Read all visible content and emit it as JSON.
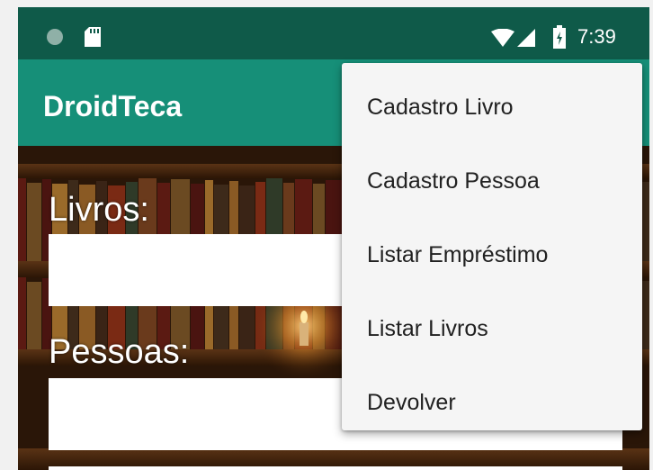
{
  "status_bar": {
    "time": "7:39",
    "icons": [
      "notification-dot-icon",
      "sd-card-icon",
      "wifi-icon",
      "signal-icon",
      "battery-icon"
    ],
    "color": "#0f5a49"
  },
  "app_bar": {
    "title": "DroidTeca",
    "color": "#168f78"
  },
  "form": {
    "livros_label": "Livros:",
    "livros_value": "",
    "pessoas_label": "Pessoas:",
    "pessoas_value": ""
  },
  "overflow_menu": {
    "items": [
      {
        "label": "Cadastro Livro"
      },
      {
        "label": "Cadastro Pessoa"
      },
      {
        "label": "Listar Empréstimo"
      },
      {
        "label": "Listar Livros"
      },
      {
        "label": "Devolver"
      }
    ]
  }
}
